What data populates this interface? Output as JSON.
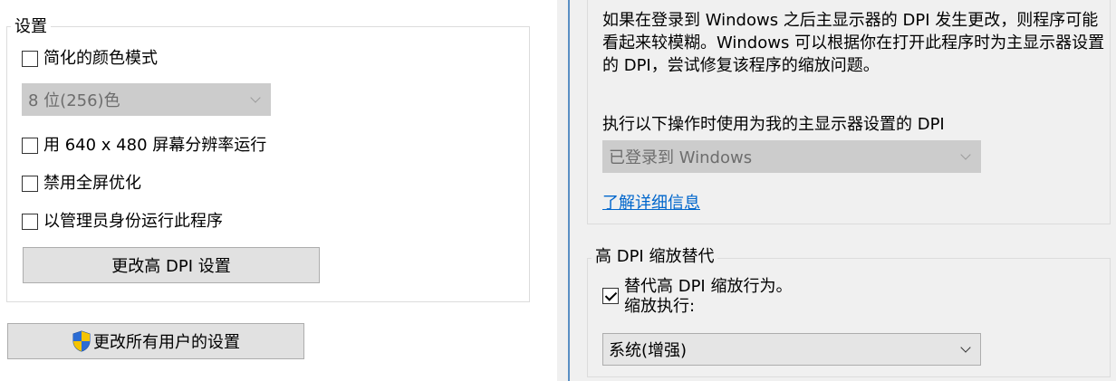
{
  "settings": {
    "group_title": "设置",
    "reduced_color_label": "简化的颜色模式",
    "color_select_value": "8 位(256)色",
    "res_640_label": "用 640 x 480 屏幕分辨率运行",
    "disable_fullscreen_opt_label": "禁用全屏优化",
    "run_as_admin_label": "以管理员身份运行此程序",
    "change_dpi_button": "更改高 DPI 设置",
    "all_users_button": "更改所有用户的设置"
  },
  "dpi_panel": {
    "description_line1": "如果在登录到 Windows 之后主显示器的 DPI 发生更改，则程序可能",
    "description_line2": "看起来较模糊。Windows 可以根据你在打开此程序时为主显示器设置",
    "description_line3": "的 DPI，尝试修复该程序的缩放问题。",
    "use_dpi_label": "执行以下操作时使用为我的主显示器设置的 DPI",
    "dpi_select_value": "已登录到 Windows",
    "learn_more_link": "了解详细信息"
  },
  "override": {
    "group_title": "高 DPI 缩放替代",
    "override_label": "替代高 DPI 缩放行为。",
    "scaling_performed_by_label": "缩放执行:",
    "scaling_select_value": "系统(增强)",
    "override_checked": true
  },
  "icons": {
    "chevron": "chevron-down-icon",
    "shield": "uac-shield-icon"
  },
  "colors": {
    "link": "#0066cc",
    "panel_bg": "#f0f0f0",
    "button_bg": "#e1e1e1",
    "disabled_bg": "#cccccc"
  }
}
